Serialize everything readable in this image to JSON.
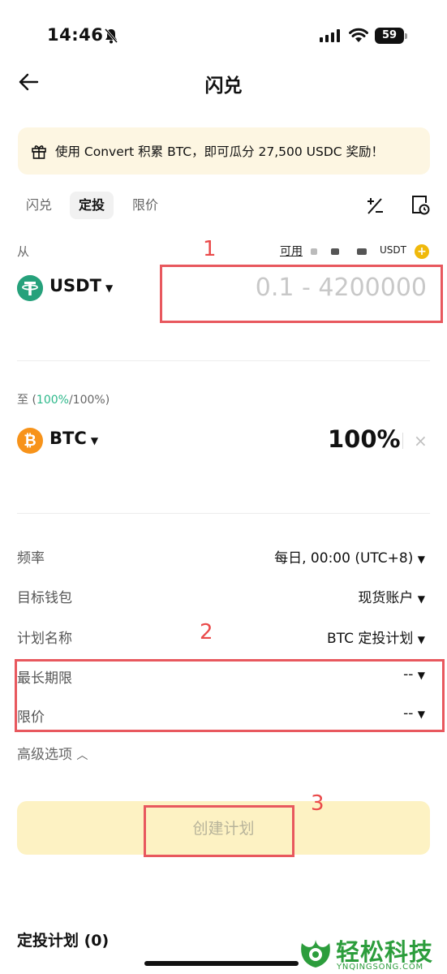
{
  "status_bar": {
    "time": "14:46",
    "battery": "59"
  },
  "header": {
    "title": "闪兑"
  },
  "promo": {
    "text": "使用 Convert 积累 BTC，即可瓜分 27,500 USDC 奖励！"
  },
  "tabs": [
    {
      "label": "闪兑"
    },
    {
      "label": "定投",
      "active": true
    },
    {
      "label": "限价"
    }
  ],
  "from": {
    "label": "从",
    "available_label": "可用",
    "available_unit": "USDT",
    "asset": "USDT",
    "amount_placeholder": "0.1 - 4200000"
  },
  "to": {
    "label_prefix": "至 (",
    "label_green": "100%",
    "label_suffix": "/100%)",
    "asset": "BTC",
    "percent": "100%",
    "remove": "×"
  },
  "settings": [
    {
      "label": "频率",
      "value": "每日, 00:00 (UTC+8)"
    },
    {
      "label": "目标钱包",
      "value": "现货账户"
    },
    {
      "label": "计划名称",
      "value": "BTC 定投计划"
    },
    {
      "label": "最长期限",
      "value": "--"
    },
    {
      "label": "限价",
      "value": "--"
    }
  ],
  "advanced": "高级选项",
  "create_button": "创建计划",
  "plans_title": "定投计划 (0)",
  "annotations": [
    "1",
    "2",
    "3"
  ],
  "watermark": {
    "text": "轻松科技",
    "sub": "YNQINGSONG.COM"
  },
  "colors": {
    "brand_yellow": "#f0b90b",
    "promo_bg": "#fdf6e2",
    "button_bg": "#fdf2c3",
    "annotation_red": "#e8585e",
    "usdt_green": "#26a17b",
    "btc_orange": "#f7931a",
    "accent_green": "#2cb88a"
  }
}
